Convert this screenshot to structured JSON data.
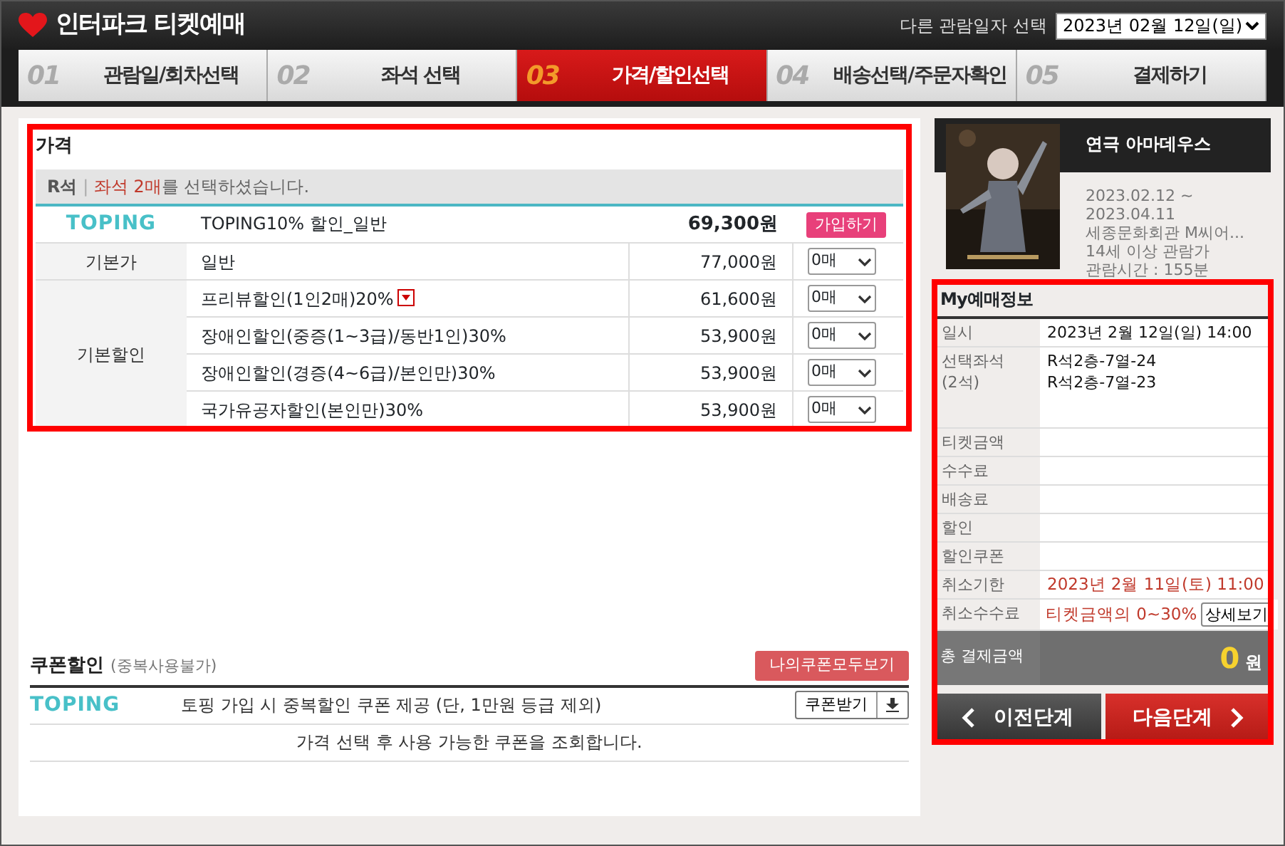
{
  "header": {
    "title": "인터파크 티켓예매",
    "date_label": "다른 관람일자 선택",
    "date_value": "2023년 02월 12일(일)"
  },
  "steps": [
    {
      "number": "01",
      "label": "관람일/회차선택",
      "selected": false
    },
    {
      "number": "02",
      "label": "좌석 선택",
      "selected": false
    },
    {
      "number": "03",
      "label": "가격/할인선택",
      "selected": true
    },
    {
      "number": "04",
      "label": "배송선택/주문자확인",
      "selected": false
    },
    {
      "number": "05",
      "label": "결제하기",
      "selected": false
    }
  ],
  "price": {
    "title": "가격",
    "highlighted": true,
    "grade": "R석",
    "separator": "|",
    "selected_seats": "좌석 2매",
    "notice": "를 선택하셨습니다.",
    "toping": {
      "logo": "TOPING",
      "name": "TOPING10% 할인_일반",
      "price": "69,300원",
      "button": "가입하기"
    },
    "groups": [
      {
        "label": "기본가",
        "rows": [
          {
            "name": "일반",
            "price": "77,000원",
            "quantity": "0매"
          }
        ]
      },
      {
        "label": "기본할인",
        "rows": [
          {
            "name": "프리뷰할인(1인2매)20%",
            "price": "61,600원",
            "quantity": "0매",
            "has_info": true
          },
          {
            "name": "장애인할인(중증(1~3급)/동반1인)30%",
            "price": "53,900원",
            "quantity": "0매"
          },
          {
            "name": "장애인할인(경증(4~6급)/본인만)30%",
            "price": "53,900원",
            "quantity": "0매"
          },
          {
            "name": "국가유공자할인(본인만)30%",
            "price": "53,900원",
            "quantity": "0매"
          }
        ]
      }
    ]
  },
  "coupon": {
    "title": "쿠폰할인",
    "note": "(중복사용불가)",
    "all_button": "나의쿠폰모두보기",
    "logo": "TOPING",
    "offer": "토핑 가입 시 중복할인 쿠폰 제공 (단, 1만원 등급 제외)",
    "get_button": "쿠폰받기",
    "message": "가격 선택 후 사용 가능한 쿠폰을 조회합니다."
  },
  "show": {
    "title": "연극 아마데우스",
    "details": [
      "2023.02.12 ~",
      "2023.04.11",
      "세종문화회관 M씨어...",
      "14세 이상 관람가",
      "관람시간 : 155분"
    ]
  },
  "my_info": {
    "title": "My예매정보",
    "highlighted": true,
    "rows": [
      {
        "kind": "text",
        "label": "일시",
        "value": "2023년 2월 12일(일) 14:00"
      },
      {
        "kind": "seats",
        "label": "선택좌석",
        "sublabel": "(2석)",
        "lines": [
          "R석2층-7열-24",
          "R석2층-7열-23"
        ]
      },
      {
        "kind": "empty",
        "label": "티켓금액"
      },
      {
        "kind": "empty",
        "label": "수수료"
      },
      {
        "kind": "empty",
        "label": "배송료"
      },
      {
        "kind": "empty",
        "label": "할인"
      },
      {
        "kind": "empty",
        "label": "할인쿠폰"
      },
      {
        "kind": "alert",
        "label": "취소기한",
        "value": "2023년 2월 11일(토) 11:00"
      },
      {
        "kind": "fee",
        "label": "취소수수료",
        "value": "티켓금액의 0~30%",
        "button": "상세보기"
      }
    ],
    "total": {
      "label": "총 결제금액",
      "amount": "0",
      "unit": "원"
    },
    "prev_button": "이전단계",
    "next_button": "다음단계"
  }
}
